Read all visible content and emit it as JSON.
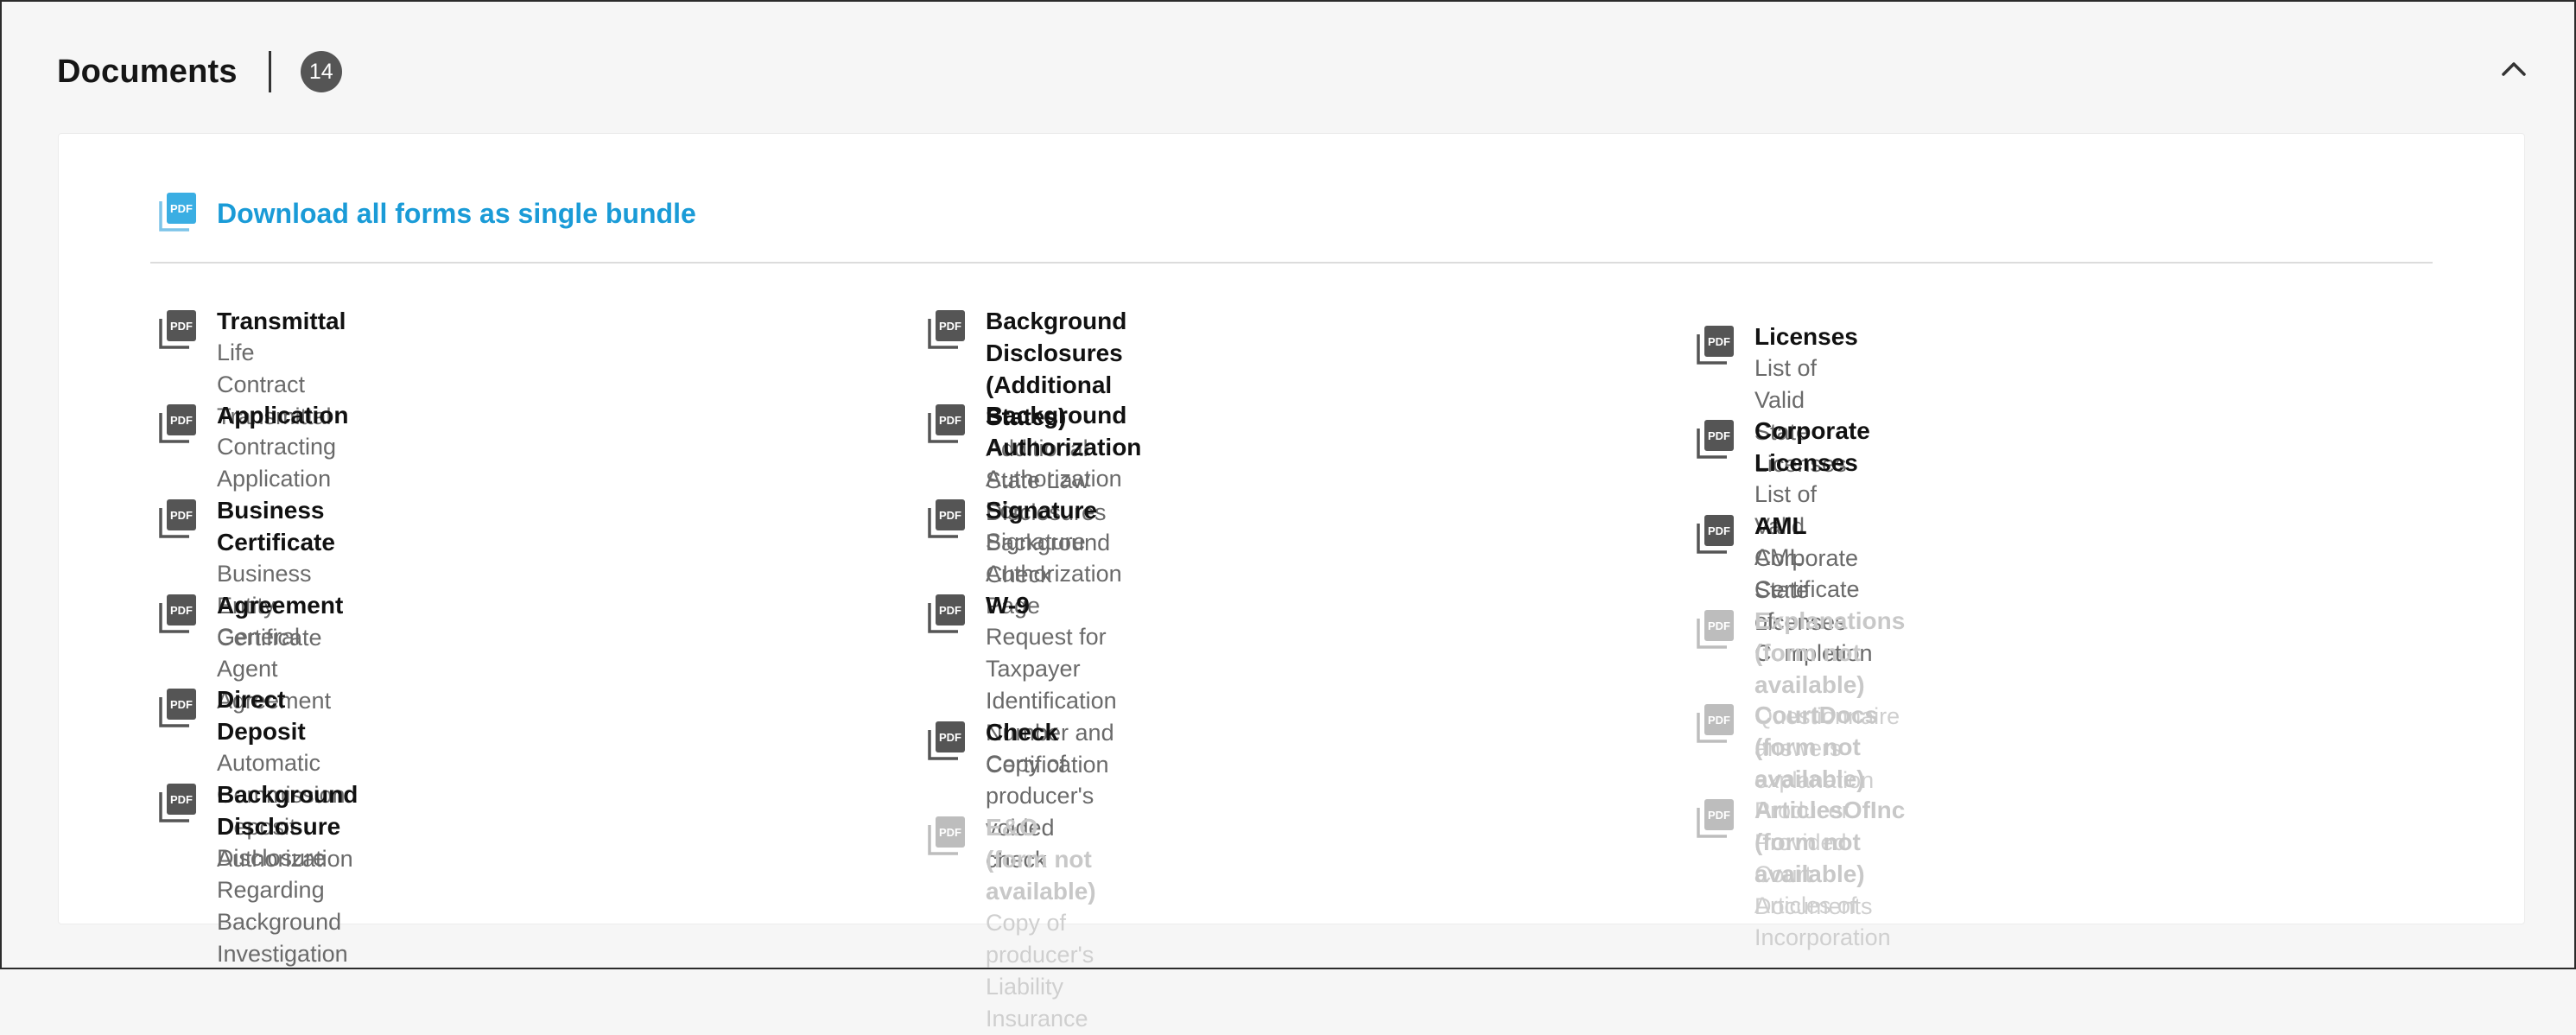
{
  "section": {
    "title": "Documents",
    "count": "14",
    "collapse_icon": "chevron-up-icon"
  },
  "bundle": {
    "label": "Download all forms as single bundle",
    "icon": "pdf-stack-icon",
    "color": "#1a9bd7"
  },
  "columns": [
    [
      {
        "name": "Transmittal",
        "desc": "Life Contract Transmittal",
        "available": true
      },
      {
        "name": "Application",
        "desc": "Contracting Application",
        "available": true
      },
      {
        "name": "Business Certificate",
        "desc": "Business Entity Certificate",
        "available": true
      },
      {
        "name": "Agreement",
        "desc": "General Agent Agreement",
        "available": true
      },
      {
        "name": "Direct Deposit",
        "desc": "Automatic Commission Deposit Authorization",
        "available": true
      },
      {
        "name": "Background Disclosure",
        "desc": "Disclosure Regarding Background Investigation",
        "available": true
      }
    ],
    [
      {
        "name": "Background Disclosures (Additional States)",
        "desc": "Additional State Law Disclosures",
        "available": true
      },
      {
        "name": "Background Authorization",
        "desc": "Authorization For Background Check",
        "available": true
      },
      {
        "name": "Signature",
        "desc": "Signature Authorization Page",
        "available": true
      },
      {
        "name": "W-9",
        "desc": "Request for Taxpayer Identification Number and\nCertification",
        "available": true
      },
      {
        "name": "Check",
        "desc": "Copy of producer's voided check",
        "available": true
      },
      {
        "name": "E&O (form not available)",
        "desc": "Copy of producer's Liability Insurance",
        "available": false
      }
    ],
    [
      {
        "name": "Licenses",
        "desc": "List of Valid State Licenses",
        "available": true
      },
      {
        "name": "Corporate Licenses",
        "desc": "List of Valid Corporate State Licenses",
        "available": true
      },
      {
        "name": "AML",
        "desc": "AML Certificate of Completion",
        "available": true
      },
      {
        "name": "Explanations (form not available)",
        "desc": "Questionnaire answers explanation",
        "available": false
      },
      {
        "name": "CourtDocs (form not available)",
        "desc": "Producer Provided Court Documents",
        "available": false
      },
      {
        "name": "ArticlesOfInc (form not available)",
        "desc": "Articles of Incorporation",
        "available": false
      }
    ]
  ],
  "icons": {
    "document": "pdf-icon"
  },
  "colors": {
    "icon_dark": "#555555",
    "icon_disabled": "#b8b8b8",
    "accent": "#1a9bd7"
  }
}
